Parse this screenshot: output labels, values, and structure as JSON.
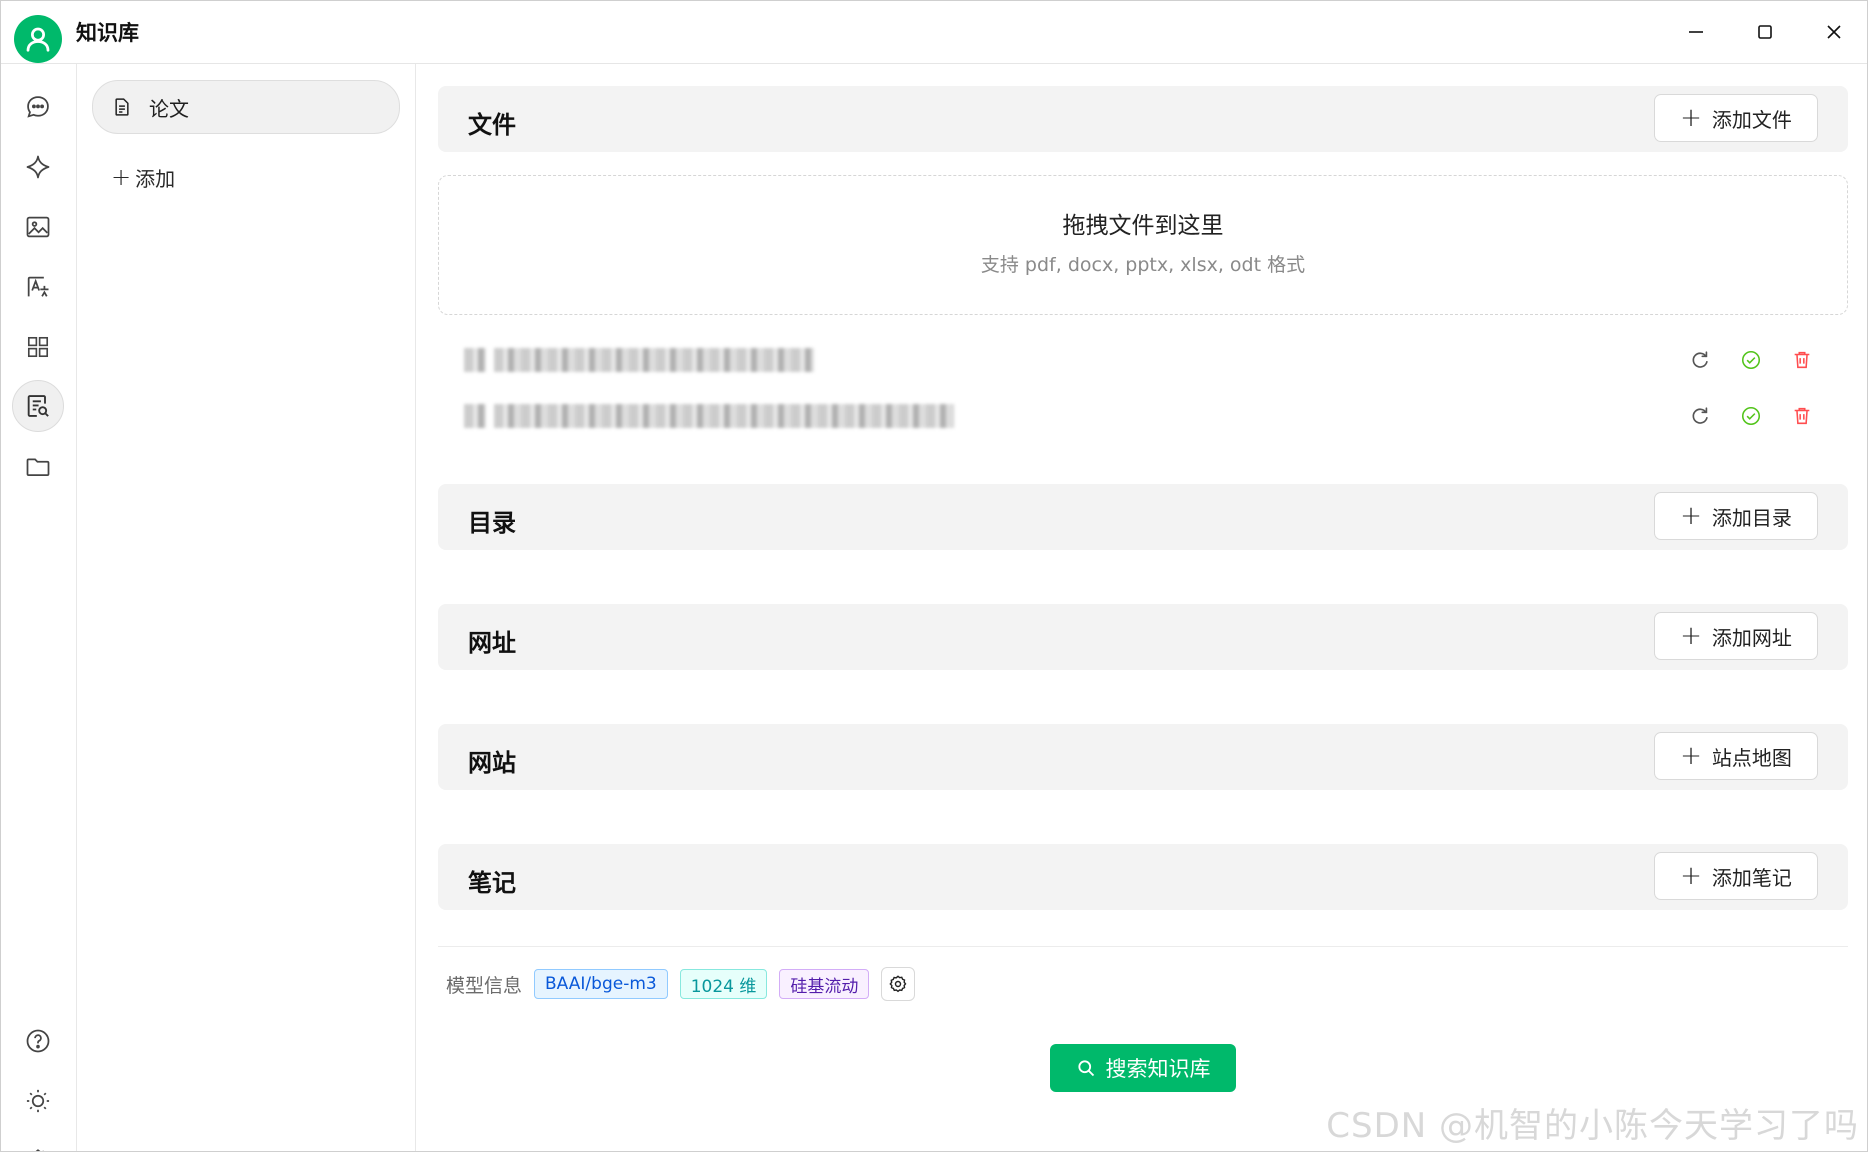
{
  "app": {
    "title": "知识库"
  },
  "window_controls": {
    "minimize": "minimize-icon",
    "maximize": "maximize-icon",
    "close": "close-icon"
  },
  "rail": {
    "top_icons": [
      "chat-icon",
      "sparkle-icon",
      "image-icon",
      "translate-icon",
      "apps-grid-icon",
      "knowledge-base-icon",
      "folder-icon"
    ],
    "bottom_icons": [
      "help-icon",
      "theme-sun-icon",
      "settings-icon"
    ],
    "active": "knowledge-base-icon"
  },
  "kb_list": {
    "items": [
      {
        "label": "论文",
        "icon": "document-icon"
      }
    ],
    "add_label": "添加"
  },
  "sections": {
    "files": {
      "title": "文件",
      "button": "添加文件"
    },
    "directory": {
      "title": "目录",
      "button": "添加目录"
    },
    "urls": {
      "title": "网址",
      "button": "添加网址"
    },
    "website": {
      "title": "网站",
      "button": "站点地图"
    },
    "notes": {
      "title": "笔记",
      "button": "添加笔记"
    }
  },
  "dropzone": {
    "title": "拖拽文件到这里",
    "subtitle": "支持 pdf, docx, pptx, xlsx, odt 格式"
  },
  "files": [
    {
      "status": "done"
    },
    {
      "status": "done"
    }
  ],
  "model_info": {
    "label": "模型信息",
    "model": "BAAI/bge-m3",
    "dimension": "1024 维",
    "provider": "硅基流动"
  },
  "search_button": "搜索知识库",
  "watermark": "CSDN @机智的小陈今天学习了吗",
  "colors": {
    "accent": "#00b96b",
    "delete": "#ff4d4f",
    "success": "#52c41a"
  }
}
